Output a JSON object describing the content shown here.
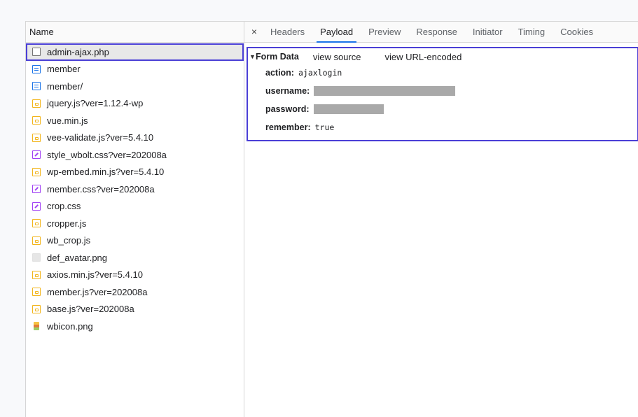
{
  "request_list": {
    "header": "Name",
    "items": [
      {
        "name": "admin-ajax.php",
        "icon": "document-icon",
        "selected": true
      },
      {
        "name": "member",
        "icon": "html-document-icon"
      },
      {
        "name": "member/",
        "icon": "html-document-icon"
      },
      {
        "name": "jquery.js?ver=1.12.4-wp",
        "icon": "script-icon"
      },
      {
        "name": "vue.min.js",
        "icon": "script-icon"
      },
      {
        "name": "vee-validate.js?ver=5.4.10",
        "icon": "script-icon"
      },
      {
        "name": "style_wbolt.css?ver=202008a",
        "icon": "stylesheet-icon"
      },
      {
        "name": "wp-embed.min.js?ver=5.4.10",
        "icon": "script-icon"
      },
      {
        "name": "member.css?ver=202008a",
        "icon": "stylesheet-icon"
      },
      {
        "name": "crop.css",
        "icon": "stylesheet-icon"
      },
      {
        "name": "cropper.js",
        "icon": "script-icon"
      },
      {
        "name": "wb_crop.js",
        "icon": "script-icon"
      },
      {
        "name": "def_avatar.png",
        "icon": "image-icon"
      },
      {
        "name": "axios.min.js?ver=5.4.10",
        "icon": "script-icon"
      },
      {
        "name": "member.js?ver=202008a",
        "icon": "script-icon"
      },
      {
        "name": "base.js?ver=202008a",
        "icon": "script-icon"
      },
      {
        "name": "wbicon.png",
        "icon": "image-icon"
      }
    ]
  },
  "details": {
    "close_glyph": "×",
    "tabs": [
      "Headers",
      "Payload",
      "Preview",
      "Response",
      "Initiator",
      "Timing",
      "Cookies"
    ],
    "active_tab": "Payload",
    "form_data": {
      "title": "Form Data",
      "view_source": "view source",
      "view_url_encoded": "view URL-encoded",
      "fields": [
        {
          "key": "action:",
          "value": "ajaxlogin"
        },
        {
          "key": "username:",
          "value": "",
          "redacted": true
        },
        {
          "key": "password:",
          "value": "",
          "redacted": true
        },
        {
          "key": "remember:",
          "value": "true"
        }
      ]
    }
  },
  "colors": {
    "highlight_outline": "#4a3fd6",
    "active_tab_underline": "#1a73e8",
    "redaction": "#a9a9a9"
  }
}
